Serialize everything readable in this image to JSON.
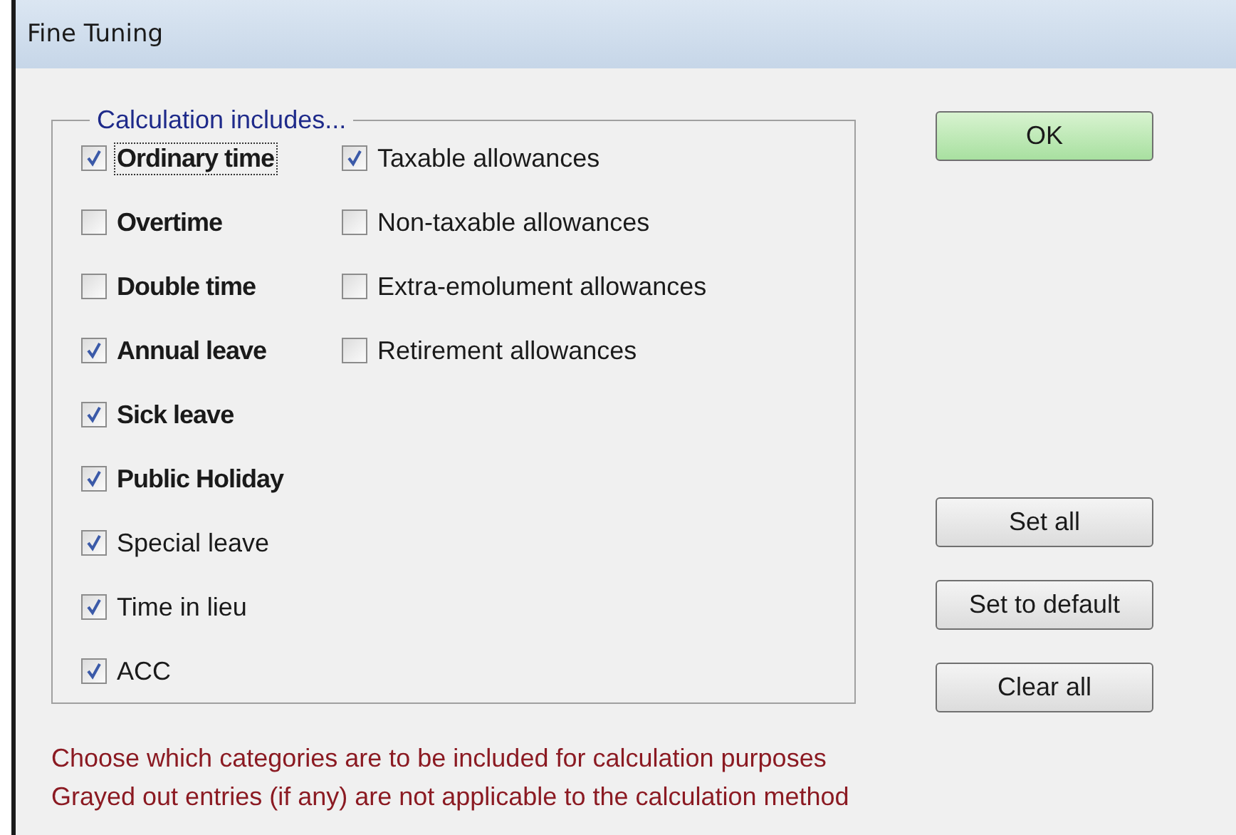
{
  "window": {
    "title": "Fine Tuning"
  },
  "group": {
    "legend": "Calculation includes...",
    "columns": [
      [
        {
          "label": "Ordinary time",
          "checked": true,
          "bold": true,
          "focused": true
        },
        {
          "label": "Overtime",
          "checked": false,
          "bold": true,
          "focused": false
        },
        {
          "label": "Double time",
          "checked": false,
          "bold": true,
          "focused": false
        },
        {
          "label": "Annual leave",
          "checked": true,
          "bold": true,
          "focused": false
        },
        {
          "label": "Sick leave",
          "checked": true,
          "bold": true,
          "focused": false
        },
        {
          "label": "Public Holiday",
          "checked": true,
          "bold": true,
          "focused": false
        },
        {
          "label": "Special leave",
          "checked": true,
          "bold": false,
          "focused": false
        },
        {
          "label": "Time in lieu",
          "checked": true,
          "bold": false,
          "focused": false
        },
        {
          "label": "ACC",
          "checked": true,
          "bold": false,
          "focused": false
        }
      ],
      [
        {
          "label": "Taxable allowances",
          "checked": true,
          "bold": false,
          "focused": false
        },
        {
          "label": "Non-taxable allowances",
          "checked": false,
          "bold": false,
          "focused": false
        },
        {
          "label": "Extra-emolument allowances",
          "checked": false,
          "bold": false,
          "focused": false
        },
        {
          "label": "Retirement allowances",
          "checked": false,
          "bold": false,
          "focused": false
        }
      ]
    ]
  },
  "ok_button": "OK",
  "buttons": [
    "Set all",
    "Set to default",
    "Clear all"
  ],
  "notes": [
    "Choose which categories are to be included for calculation purposes",
    "Grayed out entries (if any) are not applicable to the calculation method"
  ]
}
